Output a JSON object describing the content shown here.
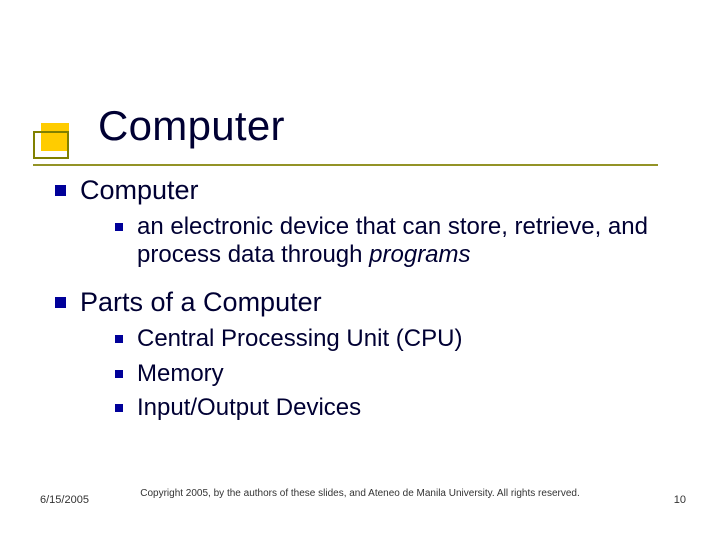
{
  "title": "Computer",
  "body": {
    "item1": {
      "label": "Computer",
      "sub1": {
        "pre": "an electronic device that can store, retrieve, and process data through ",
        "em": "programs"
      }
    },
    "item2": {
      "label": "Parts of a Computer",
      "sub1": "Central Processing Unit (CPU)",
      "sub2": "Memory",
      "sub3": "Input/Output Devices"
    }
  },
  "footer": {
    "date": "6/15/2005",
    "copyright": "Copyright 2005, by the authors of these slides, and Ateneo de Manila University. All rights reserved.",
    "page": "10"
  }
}
